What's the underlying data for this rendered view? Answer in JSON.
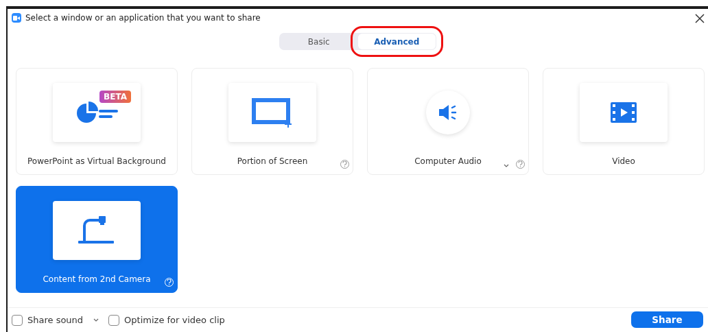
{
  "window": {
    "title": "Select a window or an application that you want to share"
  },
  "tabs": [
    {
      "label": "Basic",
      "selected": false,
      "highlighted": false
    },
    {
      "label": "Advanced",
      "selected": true,
      "highlighted": true
    }
  ],
  "options": [
    {
      "kind": "slides",
      "label": "PowerPoint as Virtual Background",
      "badge": "BETA",
      "help": false,
      "dropdown": false,
      "selected": false
    },
    {
      "kind": "portion",
      "label": "Portion of Screen",
      "help": true,
      "dropdown": false,
      "selected": false
    },
    {
      "kind": "audio",
      "label": "Computer Audio",
      "help": true,
      "dropdown": true,
      "selected": false
    },
    {
      "kind": "video",
      "label": "Video",
      "help": false,
      "dropdown": false,
      "selected": false
    },
    {
      "kind": "camera",
      "label": "Content from 2nd Camera",
      "help": true,
      "dropdown": false,
      "selected": true
    }
  ],
  "footer": {
    "checkboxes": [
      {
        "label": "Share sound",
        "checked": false,
        "dropdown": true
      },
      {
        "label": "Optimize for video clip",
        "checked": false,
        "dropdown": false
      }
    ],
    "share_button": "Share"
  }
}
